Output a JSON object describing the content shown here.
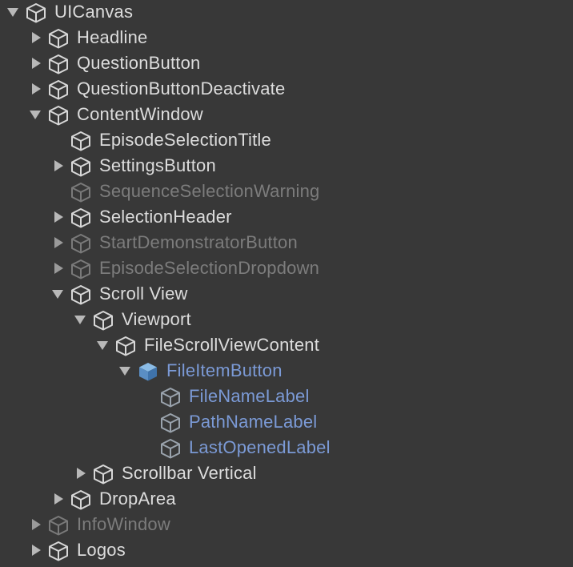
{
  "hierarchy": {
    "nodes": [
      {
        "label": "UICanvas",
        "depth": 0,
        "arrow": "expanded",
        "state": "active",
        "icon": "cube-icon"
      },
      {
        "label": "Headline",
        "depth": 1,
        "arrow": "collapsed",
        "state": "active",
        "icon": "cube-icon"
      },
      {
        "label": "QuestionButton",
        "depth": 1,
        "arrow": "collapsed",
        "state": "active",
        "icon": "cube-icon"
      },
      {
        "label": "QuestionButtonDeactivate",
        "depth": 1,
        "arrow": "collapsed",
        "state": "active",
        "icon": "cube-icon"
      },
      {
        "label": "ContentWindow",
        "depth": 1,
        "arrow": "expanded",
        "state": "active",
        "icon": "cube-icon"
      },
      {
        "label": "EpisodeSelectionTitle",
        "depth": 2,
        "arrow": "none",
        "state": "active",
        "icon": "cube-icon"
      },
      {
        "label": "SettingsButton",
        "depth": 2,
        "arrow": "collapsed",
        "state": "active",
        "icon": "cube-icon"
      },
      {
        "label": "SequenceSelectionWarning",
        "depth": 2,
        "arrow": "none",
        "state": "inactive",
        "icon": "cube-icon"
      },
      {
        "label": "SelectionHeader",
        "depth": 2,
        "arrow": "collapsed",
        "state": "active",
        "icon": "cube-icon"
      },
      {
        "label": "StartDemonstratorButton",
        "depth": 2,
        "arrow": "collapsed",
        "state": "inactive",
        "icon": "cube-icon"
      },
      {
        "label": "EpisodeSelectionDropdown",
        "depth": 2,
        "arrow": "collapsed",
        "state": "inactive",
        "icon": "cube-icon"
      },
      {
        "label": "Scroll View",
        "depth": 2,
        "arrow": "expanded",
        "state": "active",
        "icon": "cube-icon"
      },
      {
        "label": "Viewport",
        "depth": 3,
        "arrow": "expanded",
        "state": "active",
        "icon": "cube-icon"
      },
      {
        "label": "FileScrollViewContent",
        "depth": 4,
        "arrow": "expanded",
        "state": "active",
        "icon": "cube-icon"
      },
      {
        "label": "FileItemButton",
        "depth": 5,
        "arrow": "expanded",
        "state": "prefab-root",
        "icon": "prefab-cube-icon"
      },
      {
        "label": "FileNameLabel",
        "depth": 6,
        "arrow": "none",
        "state": "prefab",
        "icon": "cube-icon"
      },
      {
        "label": "PathNameLabel",
        "depth": 6,
        "arrow": "none",
        "state": "prefab",
        "icon": "cube-icon"
      },
      {
        "label": "LastOpenedLabel",
        "depth": 6,
        "arrow": "none",
        "state": "prefab",
        "icon": "cube-icon"
      },
      {
        "label": "Scrollbar Vertical",
        "depth": 3,
        "arrow": "collapsed",
        "state": "active",
        "icon": "cube-icon"
      },
      {
        "label": "DropArea",
        "depth": 2,
        "arrow": "collapsed",
        "state": "active",
        "icon": "cube-icon"
      },
      {
        "label": "InfoWindow",
        "depth": 1,
        "arrow": "collapsed",
        "state": "inactive",
        "icon": "cube-icon"
      },
      {
        "label": "Logos",
        "depth": 1,
        "arrow": "collapsed",
        "state": "active",
        "icon": "cube-icon"
      }
    ]
  },
  "colors": {
    "background": "#383838",
    "text": "#dcdcdc",
    "inactive_text": "#7c7c7c",
    "prefab_text": "#7b9ad6"
  }
}
